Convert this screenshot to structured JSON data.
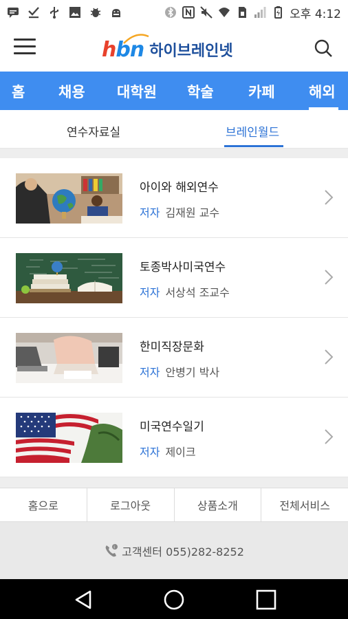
{
  "status_bar": {
    "time": "오후 4:12",
    "left_icons": [
      "message-icon",
      "download-done-icon",
      "usb-icon",
      "image-icon",
      "bug-icon",
      "android-debug-icon"
    ],
    "right_icons": [
      "bluetooth-icon",
      "nfc-icon",
      "mute-icon",
      "wifi-icon",
      "sim-icon",
      "signal-icon",
      "battery-icon"
    ]
  },
  "header": {
    "logo_mark": "hbn",
    "logo_text": "하이브레인넷",
    "menu_icon": "hamburger-menu-icon",
    "search_icon": "search-icon"
  },
  "category_nav": {
    "items": [
      {
        "label": "홈"
      },
      {
        "label": "채용"
      },
      {
        "label": "대학원"
      },
      {
        "label": "학술"
      },
      {
        "label": "카페"
      },
      {
        "label": "해외",
        "active": true
      }
    ],
    "background": "#3f8df0"
  },
  "sub_tabs": {
    "items": [
      {
        "label": "연수자료실"
      },
      {
        "label": "브레인월드",
        "active": true
      }
    ],
    "active_color": "#2d73d6"
  },
  "articles": [
    {
      "title": "아이와 해외연수",
      "meta_label": "저자",
      "author": "김재원 교수",
      "thumbnail": "teacher-globe-classroom-photo"
    },
    {
      "title": "토종박사미국연수",
      "meta_label": "저자",
      "author": "서상석 조교수",
      "thumbnail": "books-chalkboard-photo"
    },
    {
      "title": "한미직장문화",
      "meta_label": "저자",
      "author": "안병기 박사",
      "thumbnail": "laptop-office-photo"
    },
    {
      "title": "미국연수일기",
      "meta_label": "저자",
      "author": "제이크",
      "thumbnail": "american-flag-photo"
    }
  ],
  "footer": {
    "links": [
      {
        "label": "홈으로"
      },
      {
        "label": "로그아웃"
      },
      {
        "label": "상품소개"
      },
      {
        "label": "전체서비스"
      }
    ],
    "customer_center": "고객센터 055)282-8252"
  },
  "nav_bar": {
    "buttons": [
      "back-icon",
      "home-icon",
      "recents-icon"
    ]
  }
}
